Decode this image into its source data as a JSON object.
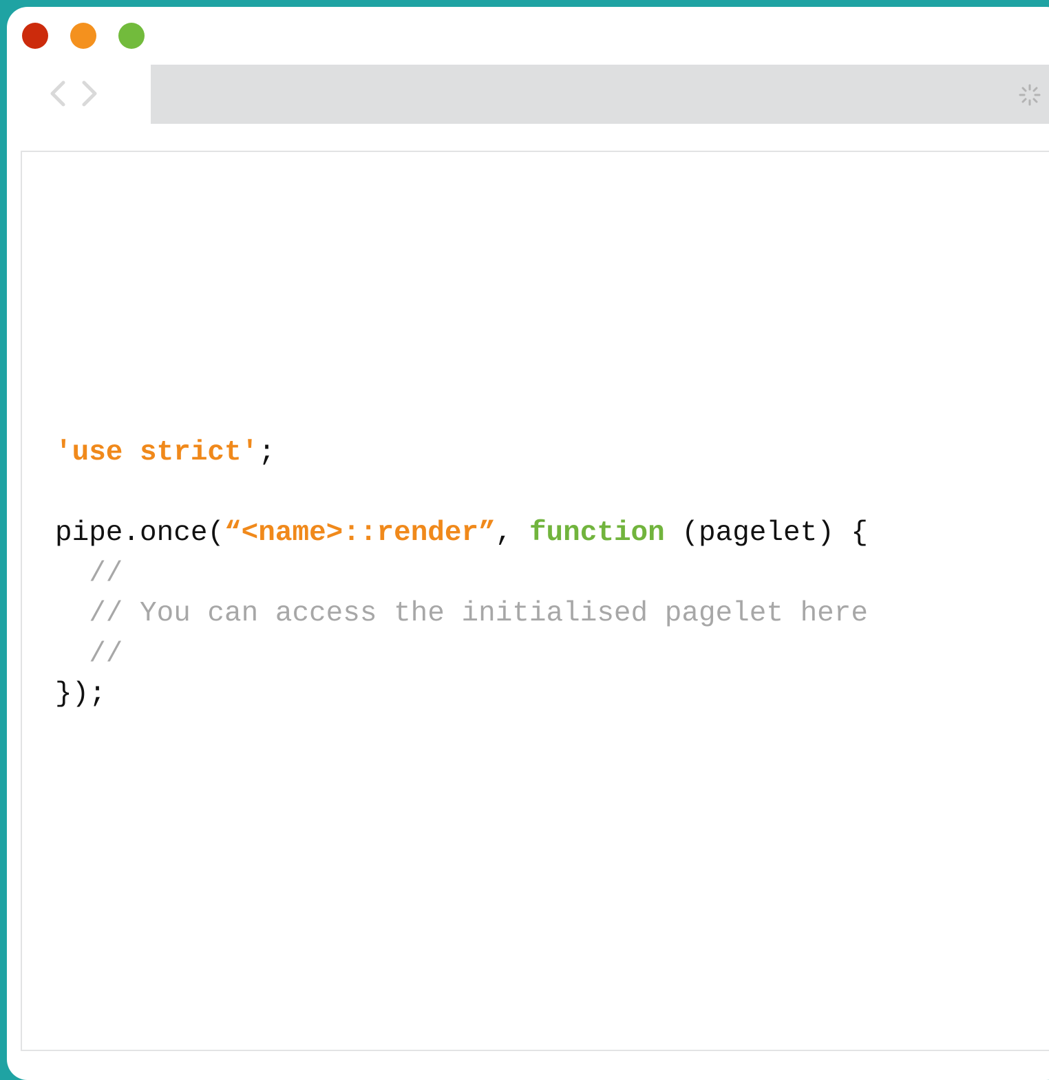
{
  "colors": {
    "background": "#1fa3a3",
    "close": "#cc2b0c",
    "minimize": "#f4911e",
    "maximize": "#72bb3c",
    "string": "#f0891b",
    "function_keyword": "#71b43d",
    "comment": "#a7a7a7",
    "default_text": "#111111",
    "address_bar": "#dedfe0"
  },
  "window": {
    "controls": [
      "close",
      "minimize",
      "maximize"
    ]
  },
  "toolbar": {
    "back_icon": "chevron-left-icon",
    "forward_icon": "chevron-right-icon",
    "loading_icon": "spinner-icon",
    "address_value": ""
  },
  "code": {
    "line1": {
      "string": "'use strict'",
      "punct": ";"
    },
    "line3": {
      "prefix": "pipe.once(",
      "event": "“<name>::render”",
      "comma": ", ",
      "keyword": "function",
      "rest": " (pagelet) {"
    },
    "line4": "  //",
    "line5": "  // You can access the initialised pagelet here",
    "line6": "  //",
    "line7": "});"
  }
}
